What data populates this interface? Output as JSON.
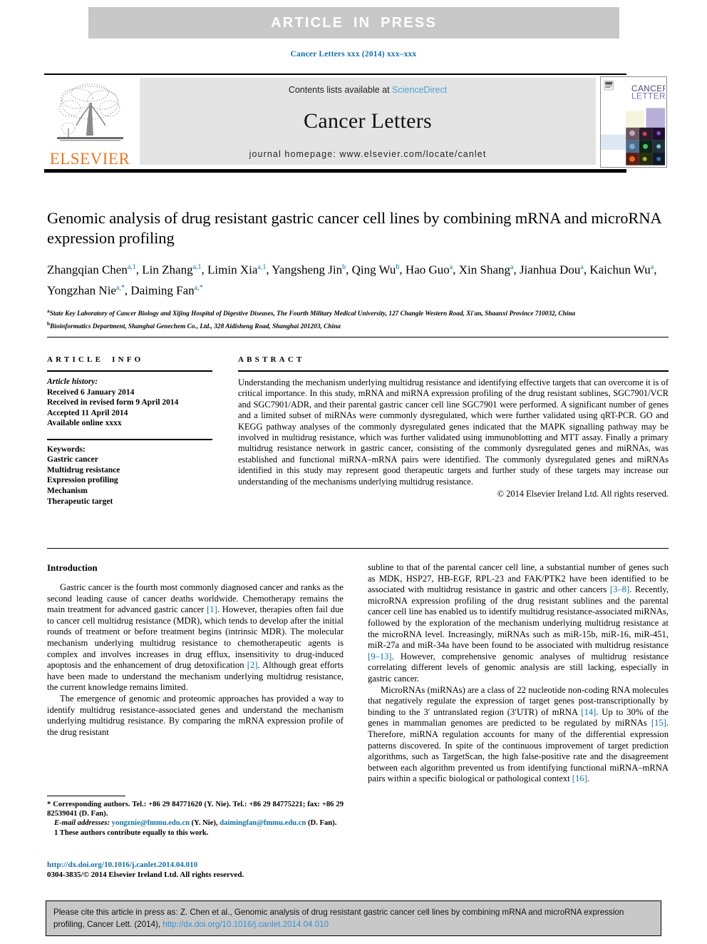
{
  "banner": {
    "label": "ARTICLE IN PRESS"
  },
  "running_head": {
    "text": "Cancer Letters xxx (2014) xxx–xxx"
  },
  "masthead": {
    "contents_prefix": "Contents lists available at ",
    "sciencedirect": "ScienceDirect",
    "journal_title": "Cancer Letters",
    "homepage": "journal homepage: www.elsevier.com/locate/canlet",
    "publisher_name": "ELSEVIER",
    "cover_title_line1": "CANCER",
    "cover_title_line2": "LETTERS"
  },
  "article": {
    "title": "Genomic analysis of drug resistant gastric cancer cell lines by combining mRNA and microRNA expression profiling",
    "authors_html": "Zhangqian Chen<sup>a,1</sup>, Lin Zhang<sup>a,1</sup>, Limin Xia<sup>a,1</sup>, Yangsheng Jin<sup>b</sup>, Qing Wu<sup>b</sup>, Hao Guo<sup>a</sup>, Xin Shang<sup>a</sup>, Jianhua Dou<sup>a</sup>, Kaichun Wu<sup>a</sup>, Yongzhan Nie<sup>a,*</sup>, Daiming Fan<sup>a,*</sup>",
    "affiliation_a": "State Key Laboratory of Cancer Biology and Xijing Hospital of Digestive Diseases, The Fourth Military Medical University, 127 Changle Western Road, Xi'an, Shaanxi Province 710032, China",
    "affiliation_b": "Bioinformatics Department, Shanghai Genechem Co., Ltd., 328 Aidisheng Road, Shanghai 201203, China"
  },
  "article_info": {
    "heading": "ARTICLE INFO",
    "history_label": "Article history:",
    "history": [
      "Received 6 January 2014",
      "Received in revised form 9 April 2014",
      "Accepted 11 April 2014",
      "Available online xxxx"
    ],
    "keywords_label": "Keywords:",
    "keywords": [
      "Gastric cancer",
      "Multidrug resistance",
      "Expression profiling",
      "Mechanism",
      "Therapeutic target"
    ]
  },
  "abstract": {
    "heading": "ABSTRACT",
    "text": "Understanding the mechanism underlying multidrug resistance and identifying effective targets that can overcome it is of critical importance. In this study, mRNA and miRNA expression profiling of the drug resistant sublines, SGC7901/VCR and SGC7901/ADR, and their parental gastric cancer cell line SGC7901 were performed. A significant number of genes and a limited subset of miRNAs were commonly dysregulated, which were further validated using qRT-PCR. GO and KEGG pathway analyses of the commonly dysregulated genes indicated that the MAPK signalling pathway may be involved in multidrug resistance, which was further validated using immunoblotting and MTT assay. Finally a primary multidrug resistance network in gastric cancer, consisting of the commonly dysregulated genes and miRNAs, was established and functional miRNA–mRNA pairs were identified. The commonly dysregulated genes and miRNAs identified in this study may represent good therapeutic targets and further study of these targets may increase our understanding of the mechanisms underlying multidrug resistance.",
    "copyright": "© 2014 Elsevier Ireland Ltd. All rights reserved."
  },
  "introduction": {
    "heading": "Introduction",
    "left_paragraphs": [
      "Gastric cancer is the fourth most commonly diagnosed cancer and ranks as the second leading cause of cancer deaths worldwide. Chemotherapy remains the main treatment for advanced gastric cancer [1]. However, therapies often fail due to cancer cell multidrug resistance (MDR), which tends to develop after the initial rounds of treatment or before treatment begins (intrinsic MDR). The molecular mechanism underlying multidrug resistance to chemotherapeutic agents is complex and involves increases in drug efflux, insensitivity to drug-induced apoptosis and the enhancement of drug detoxification [2]. Although great efforts have been made to understand the mechanism underlying multidrug resistance, the current knowledge remains limited.",
      "The emergence of genomic and proteomic approaches has provided a way to identify multidrug resistance-associated genes and understand the mechanism underlying multidrug resistance. By comparing the mRNA expression profile of the drug resistant"
    ],
    "right_paragraphs": [
      "subline to that of the parental cancer cell line, a substantial number of genes such as MDK, HSP27, HB-EGF, RPL-23 and FAK/PTK2 have been identified to be associated with multidrug resistance in gastric and other cancers [3–8]. Recently, microRNA expression profiling of the drug resistant sublines and the parental cancer cell line has enabled us to identify multidrug resistance-associated miRNAs, followed by the exploration of the mechanism underlying multidrug resistance at the microRNA level. Increasingly, miRNAs such as miR-15b, miR-16, miR-451, miR-27a and miR-34a have been found to be associated with multidrug resistance [9–13]. However, comprehensive genomic analyses of multidrug resistance correlating different levels of genomic analysis are still lacking, especially in gastric cancer.",
      "MicroRNAs (miRNAs) are a class of 22 nucleotide non-coding RNA molecules that negatively regulate the expression of target genes post-transcriptionally by binding to the 3′ untranslated region (3′UTR) of mRNA [14]. Up to 30% of the genes in mammalian genomes are predicted to be regulated by miRNAs [15]. Therefore, miRNA regulation accounts for many of the differential expression patterns discovered. In spite of the continuous improvement of target prediction algorithms, such as TargetScan, the high false-positive rate and the disagreement between each algorithm prevented us from identifying functional miRNA–mRNA pairs within a specific biological or pathological context [16]."
    ]
  },
  "footnotes": {
    "corresponding": "* Corresponding authors. Tel.: +86 29 84771620 (Y. Nie). Tel.: +86 29 84775221; fax: +86 29 82539041 (D. Fan).",
    "email_label": "E-mail addresses:",
    "email_1": "yongznie@fmmu.edu.cn",
    "email_1_owner": "(Y. Nie),",
    "email_2": "daimingfan@fmmu.edu.cn",
    "email_2_owner": "(D. Fan).",
    "equal_contribution": "1  These authors contribute equally to this work."
  },
  "doi_block": {
    "doi_url": "http://dx.doi.org/10.1016/j.canlet.2014.04.010",
    "issn_line": "0304-3835/© 2014 Elsevier Ireland Ltd. All rights reserved."
  },
  "cite_box": {
    "text_part1": "Please cite this article in press as: Z. Chen et al., Genomic analysis of drug resistant gastric cancer cell lines by combining mRNA and microRNA expression profiling, Cancer Lett. (2014), ",
    "link": "http://dx.doi.org/10.1016/j.canlet.2014.04.010"
  },
  "colors": {
    "link_blue": "#1170a8",
    "sciencedirect_blue": "#4ca3d8",
    "elsevier_orange": "#e87722",
    "banner_gray": "#c8c8c8",
    "masthead_gray": "#e4e4e4"
  }
}
